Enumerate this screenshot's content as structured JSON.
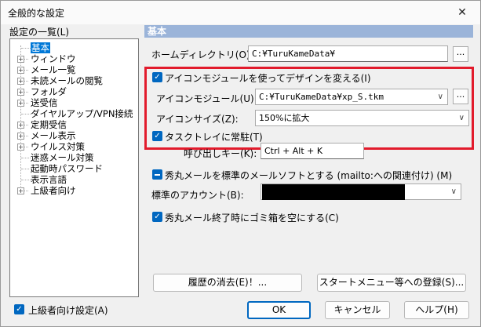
{
  "window": {
    "title": "全般的な設定",
    "close_icon": "close-icon"
  },
  "tree": {
    "label": "設定の一覧(L)",
    "items": [
      {
        "label": "基本",
        "expandable": false,
        "selected": true
      },
      {
        "label": "ウィンドウ",
        "expandable": true
      },
      {
        "label": "メール一覧",
        "expandable": true
      },
      {
        "label": "未読メールの閲覧",
        "expandable": true
      },
      {
        "label": "フォルダ",
        "expandable": true
      },
      {
        "label": "送受信",
        "expandable": true
      },
      {
        "label": "ダイヤルアップ/VPN接続",
        "expandable": false
      },
      {
        "label": "定期受信",
        "expandable": true
      },
      {
        "label": "メール表示",
        "expandable": true
      },
      {
        "label": "ウイルス対策",
        "expandable": true
      },
      {
        "label": "迷惑メール対策",
        "expandable": false
      },
      {
        "label": "起動時パスワード",
        "expandable": false
      },
      {
        "label": "表示言語",
        "expandable": false
      },
      {
        "label": "上級者向け",
        "expandable": true
      }
    ]
  },
  "advanced_checkbox": {
    "label": "上級者向け設定(A)",
    "checked": true
  },
  "panel": {
    "header": "基本",
    "home_dir": {
      "label": "ホームディレクトリ(O):",
      "value": "C:¥TuruKameData¥",
      "browse": "..."
    },
    "icon_module_check": {
      "label": "アイコンモジュールを使ってデザインを変える(I)",
      "checked": true
    },
    "icon_module": {
      "label": "アイコンモジュール(U):",
      "value": "C:¥TuruKameData¥xp_S.tkm",
      "browse": "..."
    },
    "icon_size": {
      "label": "アイコンサイズ(Z):",
      "value": "150%に拡大"
    },
    "tasktray_check": {
      "label": "タスクトレイに常駐(T)",
      "checked": true
    },
    "hotkey": {
      "label": "呼び出しキー(K):",
      "value": "Ctrl + Alt + K"
    },
    "default_mailer_check": {
      "label": "秀丸メールを標準のメールソフトとする (mailto:への関連付け) (M)",
      "state": "indeterminate"
    },
    "default_account": {
      "label": "標準のアカウント(B):",
      "value": ""
    },
    "empty_trash_check": {
      "label": "秀丸メール終了時にゴミ箱を空にする(C)",
      "checked": true
    },
    "clear_history_button": "履歴の消去(E)！...",
    "start_menu_button": "スタートメニュー等への登録(S)..."
  },
  "footer": {
    "ok": "OK",
    "cancel": "キャンセル",
    "help": "ヘルプ(H)"
  },
  "colors": {
    "accent": "#0067c0",
    "header_bg": "#9bb4d9",
    "highlight_border": "#e21b2c"
  }
}
